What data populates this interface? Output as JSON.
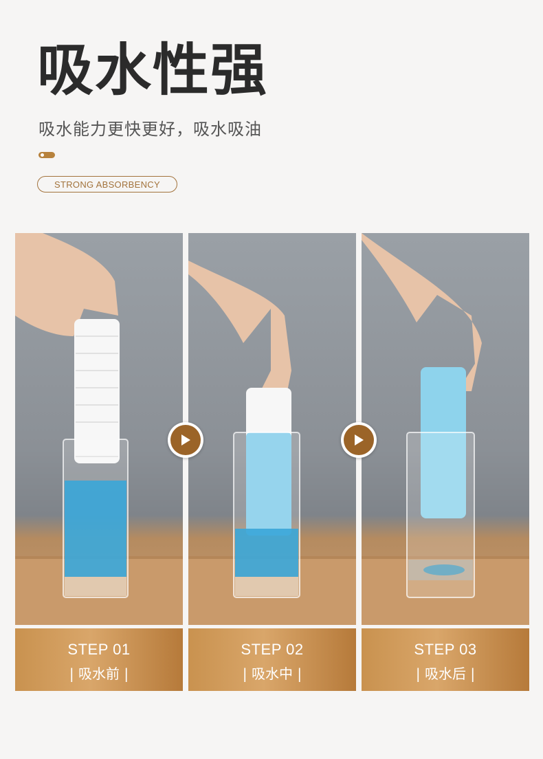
{
  "header": {
    "title": "吸水性强",
    "subtitle": "吸水能力更快更好，吸水吸油",
    "badge": "STRONG ABSORBENCY"
  },
  "steps": [
    {
      "step": "STEP 01",
      "label": "| 吸水前 |"
    },
    {
      "step": "STEP 02",
      "label": "| 吸水中 |"
    },
    {
      "step": "STEP 03",
      "label": "| 吸水后 |"
    }
  ],
  "icons": {
    "arrow": "play-arrow-icon"
  },
  "colors": {
    "accent": "#a2723b",
    "step_gradient_start": "#c9924f",
    "step_gradient_end": "#b67a3a",
    "liquid": "#3aa6d8"
  }
}
